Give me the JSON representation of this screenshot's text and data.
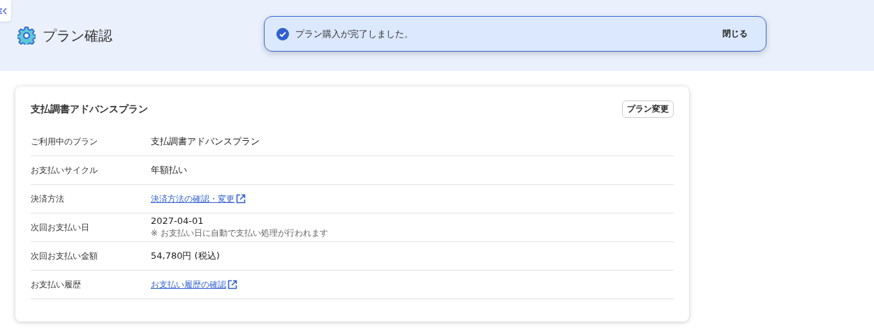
{
  "page_title": "プラン確認",
  "toast": {
    "message": "プラン購入が完了しました。",
    "close_label": "閉じる"
  },
  "card": {
    "title": "支払調書アドバンスプラン",
    "action_label": "プラン変更",
    "rows": [
      {
        "kind": "text",
        "label": "ご利用中のプラン",
        "value": "支払調書アドバンスプラン"
      },
      {
        "kind": "text",
        "label": "お支払いサイクル",
        "value": "年額払い"
      },
      {
        "kind": "link",
        "label": "決済方法",
        "value": "決済方法の確認・変更"
      },
      {
        "kind": "note",
        "label": "次回お支払い日",
        "value": "2027-04-01",
        "note": "※ お支払い日に自動で支払い処理が行われます"
      },
      {
        "kind": "text",
        "label": "次回お支払い金額",
        "value": "54,780円 (税込)"
      },
      {
        "kind": "link",
        "label": "お支払い履歴",
        "value": "お支払い履歴の確認"
      }
    ]
  }
}
